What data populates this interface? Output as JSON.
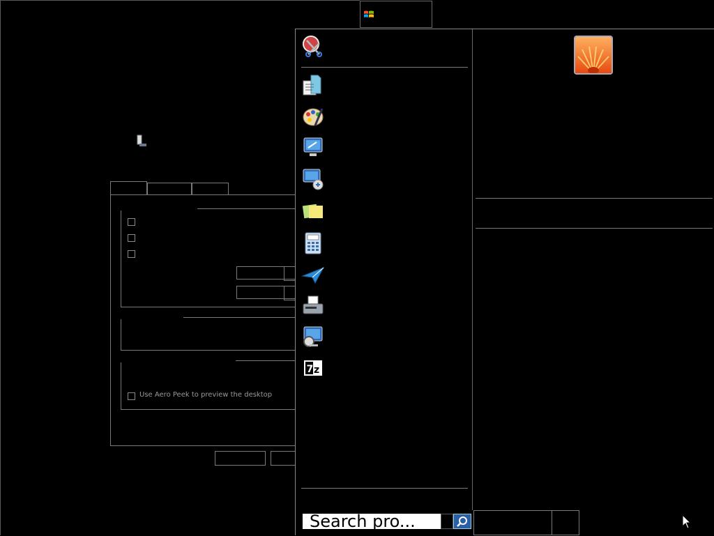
{
  "start_button": {
    "icon": "windows-flag-icon"
  },
  "dialog": {
    "checkbox_aero_peek_label": "Use Aero Peek to preview the desktop"
  },
  "start_menu": {
    "pinned": [
      {
        "name": "snipping-tool-icon"
      }
    ],
    "recent": [
      {
        "name": "wordpad-doc-icon"
      },
      {
        "name": "paint-palette-icon"
      },
      {
        "name": "remote-desktop-icon"
      },
      {
        "name": "remote-assistance-icon"
      },
      {
        "name": "sticky-notes-icon"
      },
      {
        "name": "calculator-icon"
      },
      {
        "name": "paper-plane-icon"
      },
      {
        "name": "fax-scan-icon"
      },
      {
        "name": "computer-magnifier-icon"
      },
      {
        "name": "7zip-icon"
      }
    ],
    "search": {
      "placeholder": "Search pro...",
      "value": "Search pro..."
    }
  }
}
